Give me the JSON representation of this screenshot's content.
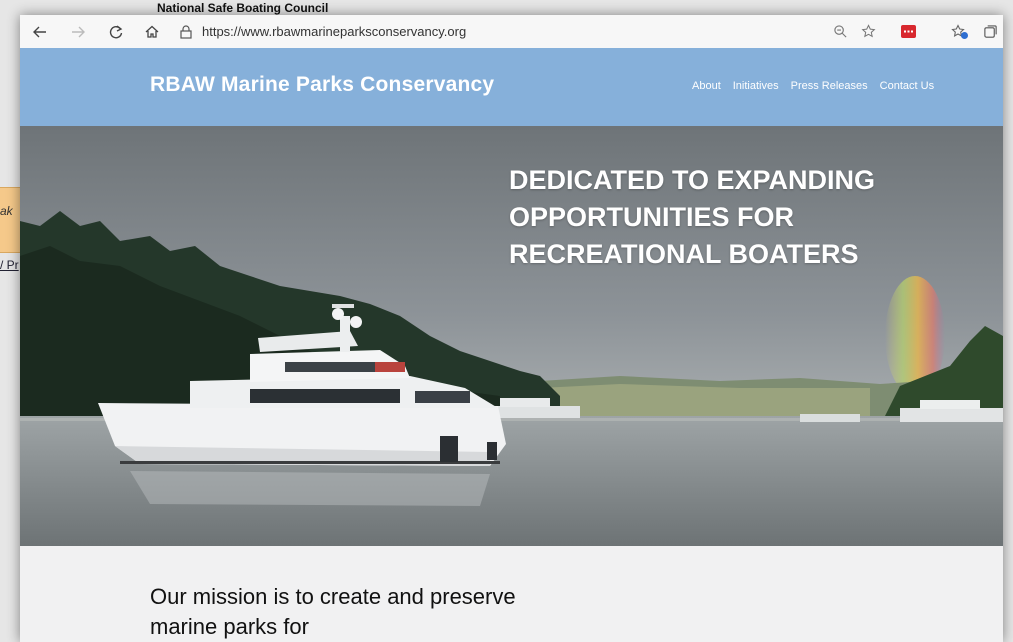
{
  "background_window": {
    "title": "National Safe Boating Council",
    "orange_fragment": "ak",
    "link_fragment": "/ Pr"
  },
  "toolbar": {
    "back_icon": "arrow-left",
    "forward_icon": "arrow-right",
    "refresh_icon": "refresh",
    "home_icon": "home",
    "url": "https://www.rbawmarineparksconservancy.org"
  },
  "header": {
    "title": "RBAW Marine Parks Conservancy",
    "nav": [
      "About",
      "Initiatives",
      "Press Releases",
      "Contact Us"
    ],
    "color": "#86b0da"
  },
  "hero": {
    "headline": "DEDICATED TO EXPANDING OPPORTUNITIES FOR RECREATIONAL BOATERS"
  },
  "mission": {
    "text": "Our mission is to create and preserve marine parks for"
  }
}
